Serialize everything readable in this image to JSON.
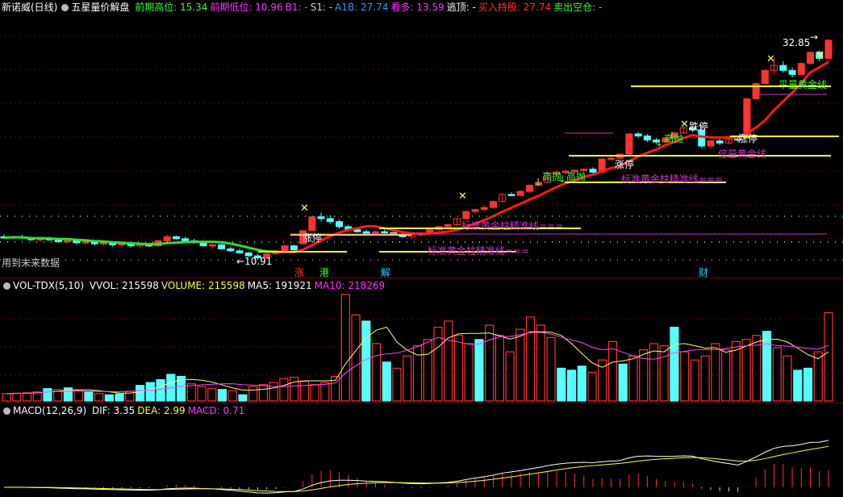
{
  "main": {
    "stock_name": "新诺威(日线)",
    "indicator_name": "五星量价解盘",
    "fields": [
      {
        "label": "前期高位:",
        "value": "15.34",
        "color": "#33ff33"
      },
      {
        "label": "前期低位:",
        "value": "10.96",
        "color": "#ff33ff"
      },
      {
        "label": "B1:",
        "value": "-",
        "color": "#ff33ff"
      },
      {
        "label": "S1:",
        "value": "-",
        "color": "#cccccc"
      },
      {
        "label": "A1B:",
        "value": "27.74",
        "color": "#3399ff"
      },
      {
        "label": "看多:",
        "value": "13.59",
        "color": "#ff33ff"
      },
      {
        "label": "逃顶:",
        "value": "-",
        "color": "#ffffff"
      },
      {
        "label": "买入持股:",
        "value": "27.74",
        "color": "#ff3333"
      },
      {
        "label": "卖出空仓:",
        "value": "-",
        "color": "#33ff33"
      }
    ],
    "future_label": "用到未来数据",
    "high_price_label": "32.85",
    "low_price_label": "←10.91",
    "signals": [
      {
        "text": "涨停",
        "color": "#ffffff"
      },
      {
        "text": "涨停",
        "color": "#ffffff"
      },
      {
        "text": "涨停",
        "color": "#ffffff"
      },
      {
        "text": "跌停",
        "color": "#ffffff"
      },
      {
        "text": "高抛",
        "color": "#33ff33"
      },
      {
        "text": "高抛",
        "color": "#33ff33"
      },
      {
        "text": "高抛",
        "color": "#33ff33"
      }
    ],
    "gold_lines": [
      {
        "text": "标准黄金柱精准线===",
        "color": "#cc33cc"
      },
      {
        "text": "标准黄金柱精准线===",
        "color": "#cc33cc"
      },
      {
        "text": "标准黄金柱精准线===",
        "color": "#cc33cc"
      },
      {
        "text": "倍量黄金线",
        "color": "#cc33cc"
      },
      {
        "text": "平量黄金线",
        "color": "#33ff33"
      }
    ],
    "bottom_tags": [
      {
        "text": "涨",
        "color": "#ff3333"
      },
      {
        "text": "港",
        "color": "#33ff33"
      },
      {
        "text": "解",
        "color": "#33ccff"
      },
      {
        "text": "财",
        "color": "#33ccff"
      }
    ]
  },
  "volume": {
    "indicator": "VOL-TDX(5,10)",
    "fields": [
      {
        "label": "VVOL:",
        "value": "215598",
        "color": "#ffffff"
      },
      {
        "label": "VOLUME:",
        "value": "215598",
        "color": "#ffff33"
      },
      {
        "label": "MA5:",
        "value": "191921",
        "color": "#ffffff"
      },
      {
        "label": "MA10:",
        "value": "218269",
        "color": "#ff33ff"
      }
    ]
  },
  "macd": {
    "indicator": "MACD(12,26,9)",
    "fields": [
      {
        "label": "DIF:",
        "value": "3.35",
        "color": "#ffffff"
      },
      {
        "label": "DEA:",
        "value": "2.99",
        "color": "#ffff33"
      },
      {
        "label": "MACD:",
        "value": "0.71",
        "color": "#ff33ff"
      }
    ]
  },
  "colors": {
    "up": "#ff3333",
    "down": "#55ffff",
    "ma": "#ff1a1a",
    "ma_green": "#33dd33",
    "grid": "#7a0000",
    "bg": "#000000",
    "yellow": "#ffff33",
    "magenta": "#cc33cc"
  },
  "chart_data": {
    "type": "candlestick",
    "price_axis_points": [
      {
        "price": 32.85,
        "label": "high"
      },
      {
        "price": 10.91,
        "label": "low"
      }
    ],
    "candles": [
      [
        13.2,
        13.4,
        13.0,
        13.1
      ],
      [
        13.1,
        13.3,
        12.9,
        13.2
      ],
      [
        13.2,
        13.4,
        13.0,
        13.1
      ],
      [
        13.1,
        13.2,
        12.8,
        12.9
      ],
      [
        12.9,
        13.1,
        12.7,
        13.0
      ],
      [
        13.0,
        13.2,
        12.8,
        12.9
      ],
      [
        12.9,
        13.0,
        12.6,
        12.7
      ],
      [
        12.7,
        12.9,
        12.5,
        12.8
      ],
      [
        12.8,
        12.9,
        12.4,
        12.6
      ],
      [
        12.6,
        12.8,
        12.4,
        12.7
      ],
      [
        12.7,
        12.8,
        12.3,
        12.5
      ],
      [
        12.5,
        12.7,
        12.3,
        12.6
      ],
      [
        12.6,
        12.7,
        12.2,
        12.4
      ],
      [
        12.4,
        12.6,
        12.2,
        12.5
      ],
      [
        12.5,
        12.6,
        12.1,
        12.3
      ],
      [
        12.3,
        12.5,
        12.1,
        12.4
      ],
      [
        12.4,
        12.6,
        12.2,
        12.3
      ],
      [
        12.3,
        12.9,
        12.2,
        12.8
      ],
      [
        12.8,
        13.4,
        12.7,
        13.2
      ],
      [
        13.2,
        13.3,
        12.9,
        13.0
      ],
      [
        13.0,
        13.2,
        12.7,
        12.8
      ],
      [
        12.8,
        13.0,
        12.5,
        12.7
      ],
      [
        12.7,
        12.8,
        12.2,
        12.3
      ],
      [
        12.3,
        12.5,
        12.0,
        12.4
      ],
      [
        12.4,
        12.5,
        11.9,
        12.0
      ],
      [
        12.0,
        12.2,
        11.7,
        11.8
      ],
      [
        11.8,
        12.0,
        11.5,
        11.6
      ],
      [
        11.6,
        11.7,
        11.2,
        11.3
      ],
      [
        11.3,
        11.5,
        10.91,
        11.1
      ],
      [
        11.1,
        11.6,
        11.0,
        11.5
      ],
      [
        11.5,
        11.9,
        11.4,
        11.8
      ],
      [
        11.8,
        12.4,
        11.7,
        12.3
      ],
      [
        12.3,
        12.4,
        11.8,
        11.9
      ],
      [
        12.5,
        13.8,
        12.4,
        13.8
      ],
      [
        13.8,
        15.2,
        13.8,
        15.18
      ],
      [
        15.18,
        15.6,
        14.7,
        15.0
      ],
      [
        15.0,
        15.34,
        14.5,
        14.7
      ],
      [
        14.7,
        14.9,
        14.0,
        14.2
      ],
      [
        14.2,
        14.4,
        13.8,
        13.9
      ],
      [
        13.9,
        14.1,
        13.6,
        13.7
      ],
      [
        13.7,
        13.9,
        13.4,
        13.5
      ],
      [
        13.5,
        13.8,
        13.3,
        13.7
      ],
      [
        13.7,
        13.9,
        13.4,
        13.6
      ],
      [
        13.6,
        13.8,
        13.3,
        13.4
      ],
      [
        13.4,
        13.6,
        13.1,
        13.2
      ],
      [
        13.2,
        13.5,
        13.0,
        13.4
      ],
      [
        13.4,
        13.6,
        13.2,
        13.5
      ],
      [
        13.5,
        14.0,
        13.4,
        13.9
      ],
      [
        13.9,
        14.3,
        13.8,
        14.2
      ],
      [
        14.2,
        14.5,
        14.0,
        14.4
      ],
      [
        14.4,
        15.0,
        14.3,
        15.0
      ],
      [
        15.0,
        15.8,
        14.9,
        15.7
      ],
      [
        15.7,
        16.0,
        15.5,
        15.9
      ],
      [
        15.9,
        16.3,
        15.7,
        16.1
      ],
      [
        16.1,
        16.8,
        16.0,
        16.7
      ],
      [
        16.7,
        17.5,
        16.6,
        17.4
      ],
      [
        17.4,
        17.6,
        17.2,
        17.3
      ],
      [
        17.3,
        17.8,
        17.2,
        17.7
      ],
      [
        17.7,
        18.4,
        17.6,
        18.3
      ],
      [
        18.3,
        19.0,
        18.2,
        18.6
      ],
      [
        18.6,
        19.6,
        18.5,
        19.5
      ],
      [
        19.5,
        19.8,
        19.3,
        19.6
      ],
      [
        19.6,
        19.9,
        19.4,
        19.7
      ],
      [
        19.7,
        19.9,
        19.5,
        19.8
      ],
      [
        19.8,
        20.0,
        19.6,
        19.9
      ],
      [
        19.9,
        20.1,
        19.5,
        19.6
      ],
      [
        19.6,
        21.0,
        19.5,
        20.9
      ],
      [
        20.9,
        21.2,
        20.7,
        21.0
      ],
      [
        21.0,
        21.5,
        20.9,
        21.4
      ],
      [
        21.4,
        23.5,
        21.3,
        23.4
      ],
      [
        23.4,
        23.6,
        23.0,
        23.2
      ],
      [
        23.2,
        23.4,
        22.6,
        22.8
      ],
      [
        22.8,
        23.0,
        22.4,
        22.6
      ],
      [
        22.6,
        23.1,
        22.5,
        23.0
      ],
      [
        23.0,
        23.6,
        22.9,
        23.5
      ],
      [
        23.5,
        24.1,
        23.4,
        24.0
      ],
      [
        24.0,
        24.2,
        23.6,
        23.8
      ],
      [
        23.8,
        24.3,
        22.0,
        22.2
      ],
      [
        22.2,
        22.8,
        22.0,
        22.7
      ],
      [
        22.7,
        23.0,
        22.3,
        22.5
      ],
      [
        22.5,
        23.0,
        22.4,
        22.9
      ],
      [
        22.9,
        23.1,
        22.6,
        22.8
      ],
      [
        23.0,
        26.9,
        22.9,
        26.9
      ],
      [
        26.9,
        28.5,
        26.8,
        28.4
      ],
      [
        28.4,
        29.8,
        28.3,
        29.7
      ],
      [
        29.7,
        31.0,
        29.3,
        30.2
      ],
      [
        30.2,
        30.6,
        29.5,
        29.7
      ],
      [
        29.7,
        30.0,
        29.0,
        29.3
      ],
      [
        29.3,
        30.5,
        29.2,
        30.4
      ],
      [
        30.4,
        31.6,
        30.3,
        31.5
      ],
      [
        31.5,
        31.7,
        30.6,
        30.9
      ],
      [
        30.9,
        32.85,
        30.8,
        32.7
      ]
    ],
    "volume_max": 260000,
    "volumes": [
      [
        18000,
        1
      ],
      [
        19000,
        1
      ],
      [
        20000,
        1
      ],
      [
        22000,
        1
      ],
      [
        30000,
        0
      ],
      [
        28000,
        1
      ],
      [
        32000,
        0
      ],
      [
        25000,
        1
      ],
      [
        22000,
        0
      ],
      [
        18000,
        1
      ],
      [
        15000,
        0
      ],
      [
        17000,
        0
      ],
      [
        24000,
        1
      ],
      [
        38000,
        0
      ],
      [
        45000,
        0
      ],
      [
        52000,
        0
      ],
      [
        65000,
        0
      ],
      [
        60000,
        0
      ],
      [
        42000,
        1
      ],
      [
        35000,
        1
      ],
      [
        30000,
        1
      ],
      [
        28000,
        0
      ],
      [
        25000,
        1
      ],
      [
        15000,
        0
      ],
      [
        35000,
        1
      ],
      [
        40000,
        1
      ],
      [
        45000,
        1
      ],
      [
        55000,
        1
      ],
      [
        58000,
        1
      ],
      [
        48000,
        1
      ],
      [
        40000,
        1
      ],
      [
        45000,
        1
      ],
      [
        60000,
        1
      ],
      [
        260000,
        1
      ],
      [
        210000,
        1
      ],
      [
        195000,
        0
      ],
      [
        140000,
        1
      ],
      [
        95000,
        0
      ],
      [
        80000,
        1
      ],
      [
        110000,
        1
      ],
      [
        135000,
        1
      ],
      [
        150000,
        1
      ],
      [
        180000,
        1
      ],
      [
        195000,
        1
      ],
      [
        160000,
        1
      ],
      [
        140000,
        1
      ],
      [
        150000,
        0
      ],
      [
        185000,
        1
      ],
      [
        160000,
        1
      ],
      [
        120000,
        1
      ],
      [
        175000,
        1
      ],
      [
        205000,
        1
      ],
      [
        185000,
        1
      ],
      [
        155000,
        1
      ],
      [
        80000,
        0
      ],
      [
        75000,
        0
      ],
      [
        85000,
        0
      ],
      [
        70000,
        1
      ],
      [
        100000,
        1
      ],
      [
        145000,
        1
      ],
      [
        90000,
        0
      ],
      [
        110000,
        1
      ],
      [
        125000,
        1
      ],
      [
        140000,
        1
      ],
      [
        135000,
        1
      ],
      [
        180000,
        0
      ],
      [
        120000,
        1
      ],
      [
        100000,
        1
      ],
      [
        110000,
        1
      ],
      [
        140000,
        1
      ],
      [
        125000,
        1
      ],
      [
        145000,
        1
      ],
      [
        150000,
        1
      ],
      [
        160000,
        1
      ],
      [
        170000,
        0
      ],
      [
        130000,
        1
      ],
      [
        110000,
        1
      ],
      [
        75000,
        0
      ],
      [
        80000,
        0
      ],
      [
        120000,
        1
      ],
      [
        215598,
        1
      ]
    ]
  }
}
